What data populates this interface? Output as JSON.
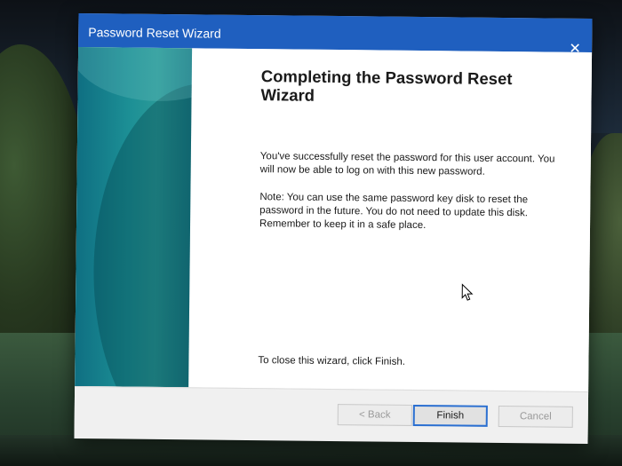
{
  "window": {
    "title": "Password Reset Wizard",
    "close_glyph": "✕"
  },
  "content": {
    "heading": "Completing the Password Reset Wizard",
    "paragraph1": "You've successfully reset the password for this user account. You will now be able to log on with this new password.",
    "paragraph2": "Note: You can use the same password key disk to reset the password in the future. You do not need to update this disk. Remember to keep it in a safe place.",
    "close_instruction": "To close this wizard, click Finish."
  },
  "buttons": {
    "back": "< Back",
    "finish": "Finish",
    "cancel": "Cancel"
  },
  "colors": {
    "titlebar": "#1f5fbf",
    "side_panel": "#1c8f95",
    "focus_border": "#2a6fd1"
  },
  "icons": {
    "close": "close-icon",
    "pointer": "mouse-pointer-icon"
  }
}
